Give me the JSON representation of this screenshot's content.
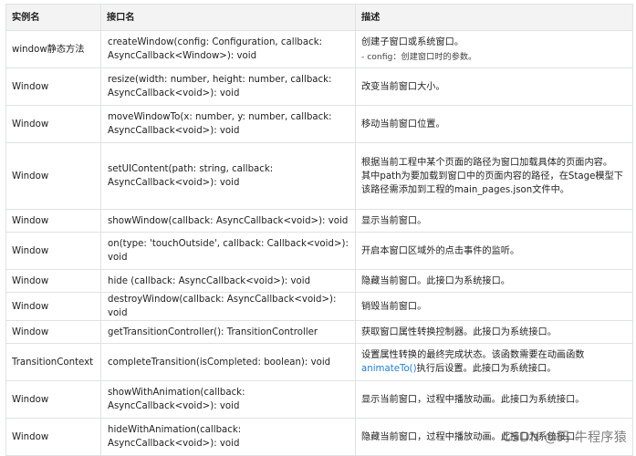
{
  "headers": [
    "实例名",
    "接口名",
    "描述"
  ],
  "rows": [
    {
      "instance": "window静态方法",
      "method": "createWindow(config: Configuration, callback: AsyncCallback<Window>): void",
      "description": "创建子窗口或系统窗口。",
      "param_note": "- config：创建窗口时的参数。"
    },
    {
      "instance": "Window",
      "method": "resize(width: number, height: number, callback: AsyncCallback<void>): void",
      "description": "改变当前窗口大小。"
    },
    {
      "instance": "Window",
      "method": "moveWindowTo(x: number, y: number, callback: AsyncCallback<void>): void",
      "description": "移动当前窗口位置。"
    },
    {
      "instance": "Window",
      "method": "setUIContent(path: string, callback: AsyncCallback<void>): void",
      "description": "根据当前工程中某个页面的路径为窗口加载具体的页面内容。",
      "description_2": "其中path为要加载到窗口中的页面内容的路径，在Stage模型下该路径需添加到工程的main_pages.json文件中。"
    },
    {
      "instance": "Window",
      "method": "showWindow(callback: AsyncCallback<void>): void",
      "description": "显示当前窗口。"
    },
    {
      "instance": "Window",
      "method": "on(type: 'touchOutside', callback: Callback<void>): void",
      "description": "开启本窗口区域外的点击事件的监听。"
    },
    {
      "instance": "Window",
      "method": "hide (callback: AsyncCallback<void>): void",
      "description": "隐藏当前窗口。此接口为系统接口。"
    },
    {
      "instance": "Window",
      "method": "destroyWindow(callback: AsyncCallback<void>): void",
      "description": "销毁当前窗口。"
    },
    {
      "instance": "Window",
      "method": "getTransitionController(): TransitionController",
      "description": "获取窗口属性转换控制器。此接口为系统接口。"
    },
    {
      "instance": "TransitionContext",
      "method": "completeTransition(isCompleted: boolean): void",
      "description": "设置属性转换的最终完成状态。该函数需要在动画函数",
      "link": "animateTo()",
      "description_after_link": "执行后设置。此接口为系统接口。"
    },
    {
      "instance": "Window",
      "method": "showWithAnimation(callback: AsyncCallback<void>): void",
      "description": "显示当前窗口，过程中播放动画。此接口为系统接口。"
    },
    {
      "instance": "Window",
      "method": "hideWithAnimation(callback: AsyncCallback<void>): void",
      "description": "隐藏当前窗口，过程中播放动画。此接口为系统接口。"
    }
  ],
  "watermark": "CSDN @码 牛程序猿",
  "colors": {
    "header_bg": "#f3f3f3",
    "border": "#dfe2e5",
    "link": "#1f7fd6",
    "text": "#222222"
  }
}
